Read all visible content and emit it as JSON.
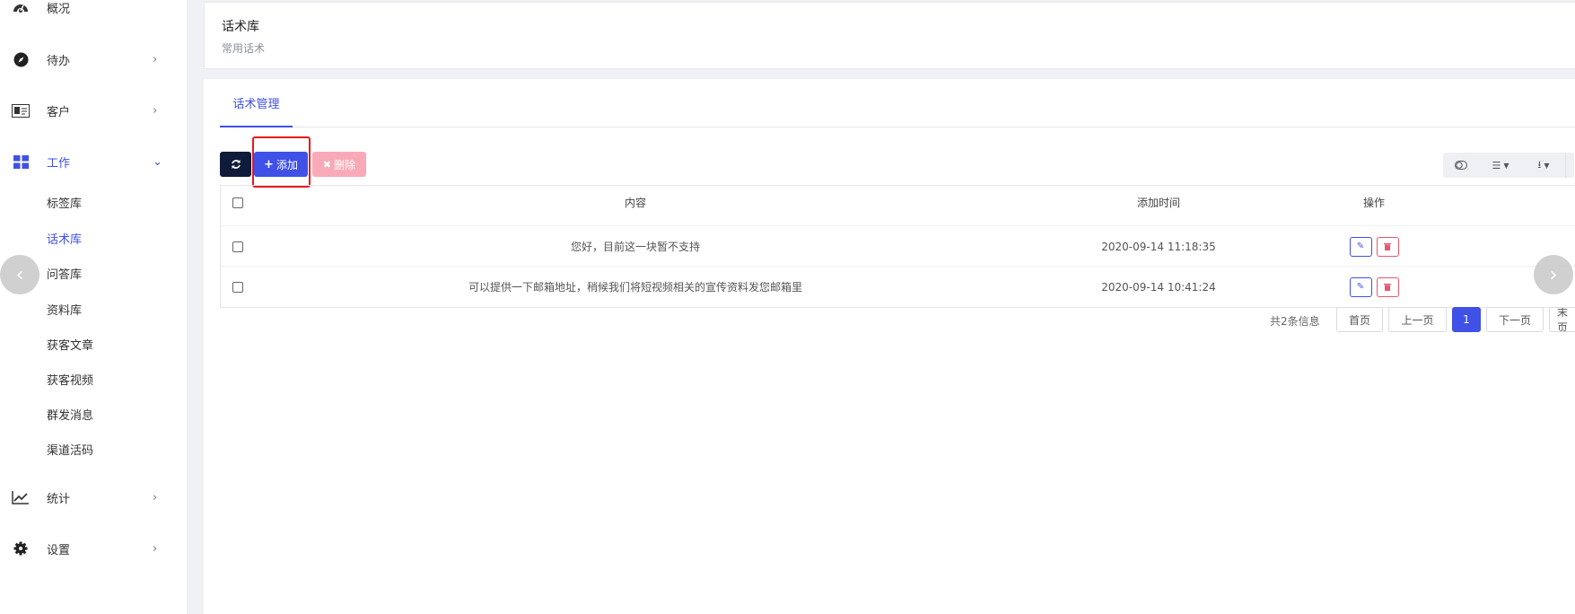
{
  "sidebar": {
    "items": [
      {
        "label": "概况",
        "icon": "dashboard-icon",
        "arrow": ""
      },
      {
        "label": "待办",
        "icon": "compass-icon",
        "arrow": "›"
      },
      {
        "label": "客户",
        "icon": "id-card-icon",
        "arrow": "›"
      },
      {
        "label": "工作",
        "icon": "grid-icon",
        "arrow": "⌄"
      },
      {
        "label": "统计",
        "icon": "line-chart-icon",
        "arrow": "›"
      },
      {
        "label": "设置",
        "icon": "gear-icon",
        "arrow": "›"
      }
    ],
    "sub_items": [
      "标签库",
      "话术库",
      "问答库",
      "资料库",
      "获客文章",
      "获客视频",
      "群发消息",
      "渠道活码"
    ],
    "active_sub": "话术库"
  },
  "header": {
    "title": "话术库",
    "subtitle": "常用话术"
  },
  "tabs": [
    {
      "label": "话术管理"
    }
  ],
  "toolbar": {
    "add_label": "添加",
    "delete_label": "删除"
  },
  "table": {
    "columns": [
      "内容",
      "添加时间",
      "操作"
    ],
    "rows": [
      {
        "content": "您好，目前这一块暂不支持",
        "time": "2020-09-14 11:18:35"
      },
      {
        "content": "可以提供一下邮箱地址，稍候我们将短视频相关的宣传资料发您邮箱里",
        "time": "2020-09-14 10:41:24"
      }
    ]
  },
  "pagination": {
    "info": "共2条信息",
    "first": "首页",
    "prev": "上一页",
    "current": "1",
    "next": "下一页",
    "last": "末页"
  },
  "colors": {
    "primary": "#3f51e6",
    "dark": "#0f1b3a",
    "danger_light": "#f9aab8",
    "highlight": "#e5191b"
  }
}
